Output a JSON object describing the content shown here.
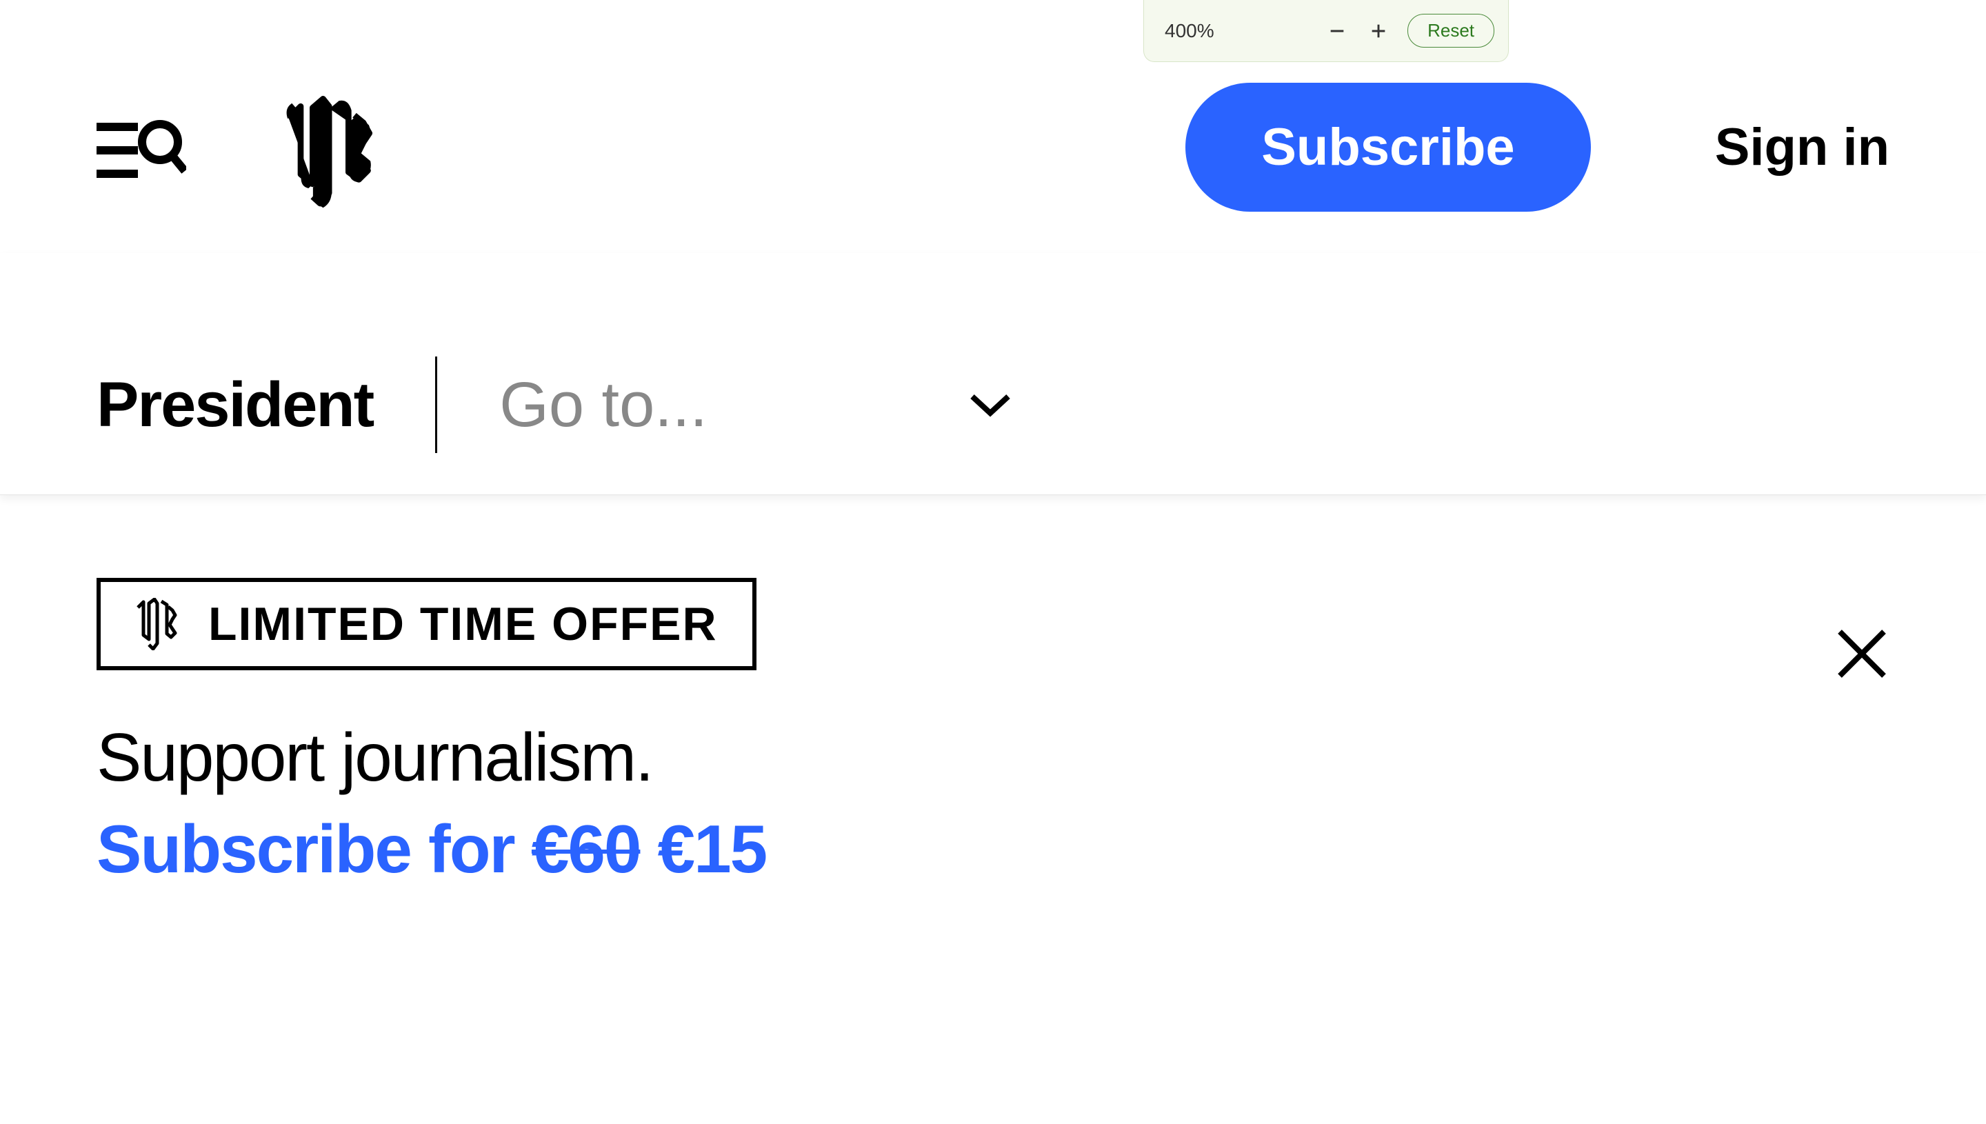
{
  "zoom": {
    "percent": "400%",
    "reset_label": "Reset"
  },
  "header": {
    "subscribe_label": "Subscribe",
    "signin_label": "Sign in"
  },
  "nav": {
    "title": "President",
    "dropdown_label": "Go to..."
  },
  "promo": {
    "badge_text": "LIMITED TIME OFFER",
    "headline": "Support journalism.",
    "cta_prefix": "Subscribe for ",
    "cta_strike": "€60",
    "cta_price": " €15"
  }
}
